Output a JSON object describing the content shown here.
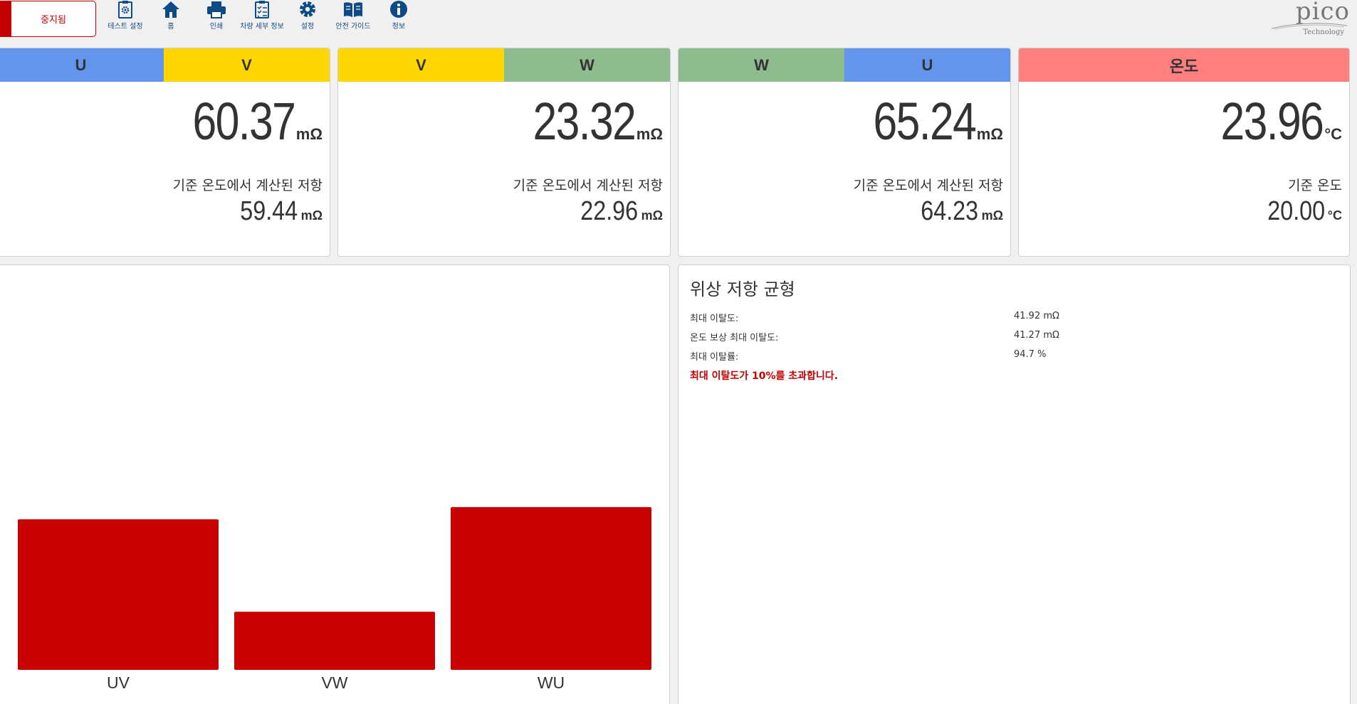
{
  "status": {
    "label": "중지됨"
  },
  "toolbar": [
    {
      "label": "테스트 설정",
      "icon": "test-settings-icon"
    },
    {
      "label": "홈",
      "icon": "home-icon"
    },
    {
      "label": "인쇄",
      "icon": "print-icon"
    },
    {
      "label": "차량 세부 정보",
      "icon": "vehicle-details-icon"
    },
    {
      "label": "설정",
      "icon": "gear-icon"
    },
    {
      "label": "안전 가이드",
      "icon": "book-icon"
    },
    {
      "label": "정보",
      "icon": "info-icon"
    }
  ],
  "logo": {
    "word": "pico",
    "sub": "Technology"
  },
  "colors": {
    "u": "#6495ed",
    "v": "#ffd700",
    "w": "#8fbc8f",
    "temp": "#ff7f7f",
    "bar": "#c80000",
    "accent": "#c40000",
    "icon": "#0d4a86"
  },
  "cards": [
    {
      "heads": [
        "U",
        "V"
      ],
      "value": "60.37",
      "unit": "mΩ",
      "ref_label": "기준 온도에서 계산된 저항",
      "ref_value": "59.44",
      "ref_unit": "mΩ"
    },
    {
      "heads": [
        "V",
        "W"
      ],
      "value": "23.32",
      "unit": "mΩ",
      "ref_label": "기준 온도에서 계산된 저항",
      "ref_value": "22.96",
      "ref_unit": "mΩ"
    },
    {
      "heads": [
        "W",
        "U"
      ],
      "value": "65.24",
      "unit": "mΩ",
      "ref_label": "기준 온도에서 계산된 저항",
      "ref_value": "64.23",
      "ref_unit": "mΩ"
    },
    {
      "heads": [
        "온도"
      ],
      "value": "23.96",
      "unit": "°C",
      "ref_label": "기준 온도",
      "ref_value": "20.00",
      "ref_unit": "°C"
    }
  ],
  "balance": {
    "title": "위상 저항 균형",
    "rows": [
      {
        "label": "최대 이탈도:",
        "value": "41.92 mΩ"
      },
      {
        "label": "온도 보상 최대 이탈도:",
        "value": "41.27 mΩ"
      },
      {
        "label": "최대 이탈률:",
        "value": "94.7 %"
      }
    ],
    "warning": "최대 이탈도가 10%를 초과합니다."
  },
  "chart_data": {
    "type": "bar",
    "categories": [
      "UV",
      "VW",
      "WU"
    ],
    "values": [
      59.44,
      22.96,
      64.23
    ],
    "ylim": [
      0,
      80
    ],
    "grid": false,
    "color": "#c80000"
  }
}
